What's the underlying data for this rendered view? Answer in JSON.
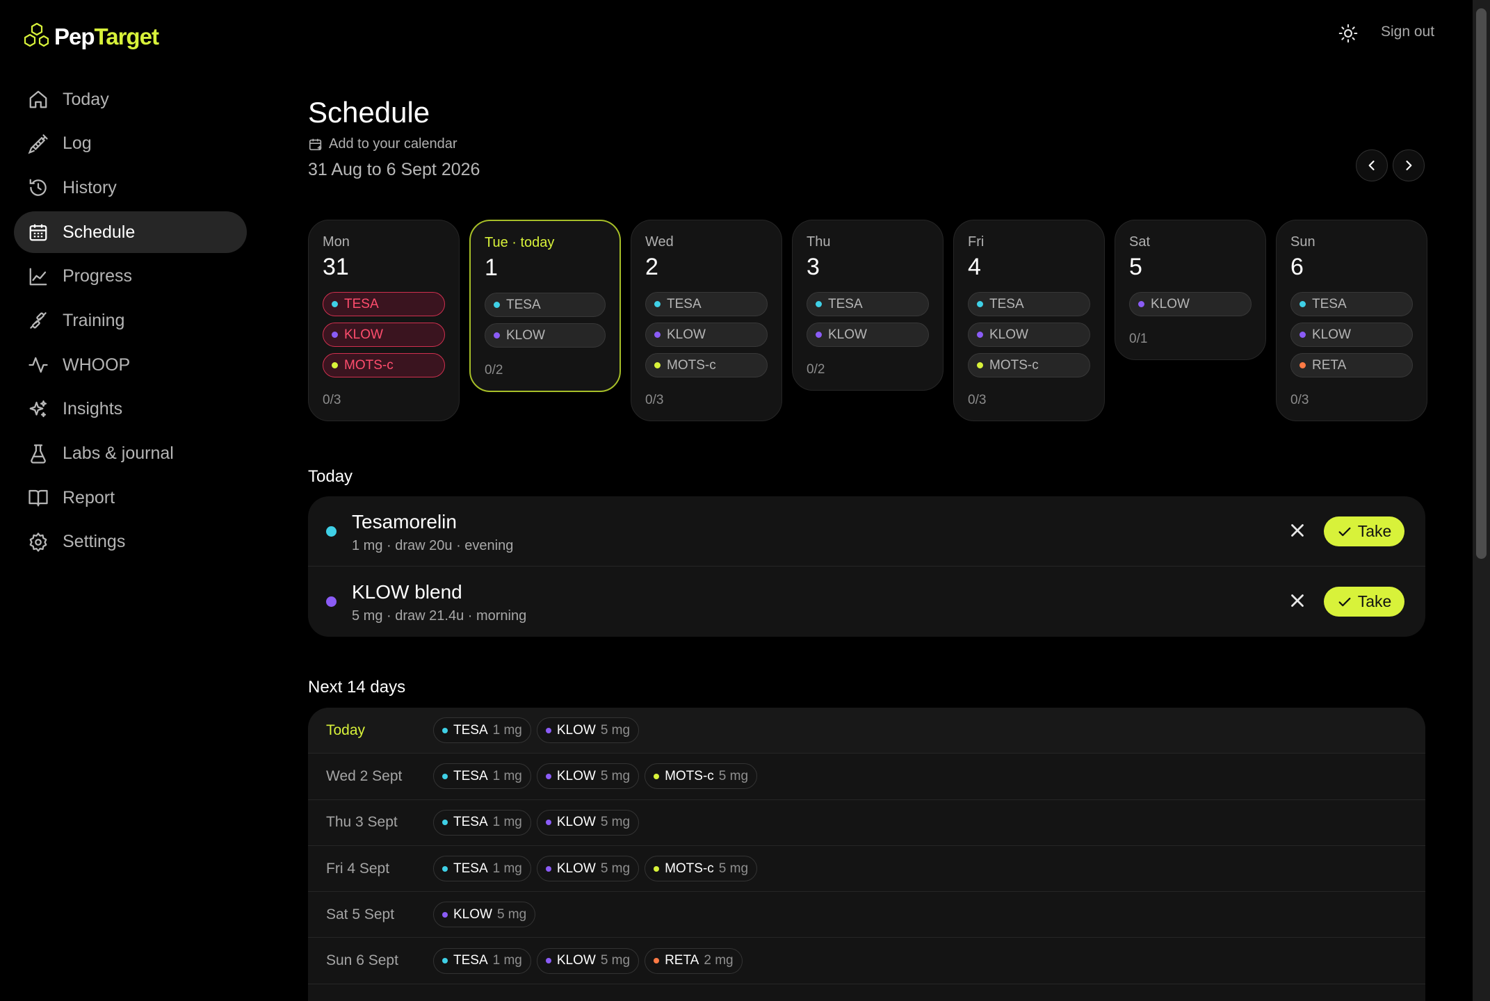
{
  "colors": {
    "accent": "#d8f23a",
    "tesa": "#3fd0e6",
    "klow": "#8b5cf6",
    "mots": "#d8f23a",
    "reta": "#ff7a45",
    "missed": "#ff4d6d"
  },
  "brand": {
    "name_part1": "Pep",
    "name_part2": "Target",
    "logo_icon": "hexagon-cluster-icon"
  },
  "topbar": {
    "theme_icon": "sun-icon",
    "sign_out": "Sign out"
  },
  "sidebar": {
    "items": [
      {
        "label": "Today",
        "icon": "home-icon",
        "active": false
      },
      {
        "label": "Log",
        "icon": "syringe-icon",
        "active": false
      },
      {
        "label": "History",
        "icon": "history-icon",
        "active": false
      },
      {
        "label": "Schedule",
        "icon": "calendar-icon",
        "active": true
      },
      {
        "label": "Progress",
        "icon": "line-chart-icon",
        "active": false
      },
      {
        "label": "Training",
        "icon": "dumbbell-icon",
        "active": false
      },
      {
        "label": "WHOOP",
        "icon": "pulse-icon",
        "active": false
      },
      {
        "label": "Insights",
        "icon": "sparkles-icon",
        "active": false
      },
      {
        "label": "Labs & journal",
        "icon": "flask-icon",
        "active": false
      },
      {
        "label": "Report",
        "icon": "book-icon",
        "active": false
      },
      {
        "label": "Settings",
        "icon": "gear-icon",
        "active": false
      }
    ]
  },
  "header": {
    "title": "Schedule",
    "add_to_calendar": "Add to your calendar",
    "date_range": "31 Aug to 6 Sept 2026",
    "prev_icon": "chevron-left-icon",
    "next_icon": "chevron-right-icon"
  },
  "week": [
    {
      "day": "Mon",
      "date": "31",
      "today": false,
      "count": "0/3",
      "doses": [
        {
          "label": "TESA",
          "color": "tesa",
          "missed": true
        },
        {
          "label": "KLOW",
          "color": "klow",
          "missed": true
        },
        {
          "label": "MOTS-c",
          "color": "mots",
          "missed": true
        }
      ]
    },
    {
      "day": "Tue · today",
      "date": "1",
      "today": true,
      "count": "0/2",
      "doses": [
        {
          "label": "TESA",
          "color": "tesa",
          "missed": false
        },
        {
          "label": "KLOW",
          "color": "klow",
          "missed": false
        }
      ]
    },
    {
      "day": "Wed",
      "date": "2",
      "today": false,
      "count": "0/3",
      "doses": [
        {
          "label": "TESA",
          "color": "tesa",
          "missed": false
        },
        {
          "label": "KLOW",
          "color": "klow",
          "missed": false
        },
        {
          "label": "MOTS-c",
          "color": "mots",
          "missed": false
        }
      ]
    },
    {
      "day": "Thu",
      "date": "3",
      "today": false,
      "count": "0/2",
      "doses": [
        {
          "label": "TESA",
          "color": "tesa",
          "missed": false
        },
        {
          "label": "KLOW",
          "color": "klow",
          "missed": false
        }
      ]
    },
    {
      "day": "Fri",
      "date": "4",
      "today": false,
      "count": "0/3",
      "doses": [
        {
          "label": "TESA",
          "color": "tesa",
          "missed": false
        },
        {
          "label": "KLOW",
          "color": "klow",
          "missed": false
        },
        {
          "label": "MOTS-c",
          "color": "mots",
          "missed": false
        }
      ]
    },
    {
      "day": "Sat",
      "date": "5",
      "today": false,
      "count": "0/1",
      "doses": [
        {
          "label": "KLOW",
          "color": "klow",
          "missed": false
        }
      ]
    },
    {
      "day": "Sun",
      "date": "6",
      "today": false,
      "count": "0/3",
      "doses": [
        {
          "label": "TESA",
          "color": "tesa",
          "missed": false
        },
        {
          "label": "KLOW",
          "color": "klow",
          "missed": false
        },
        {
          "label": "RETA",
          "color": "reta",
          "missed": false
        }
      ]
    }
  ],
  "today_section": {
    "label": "Today",
    "doses": [
      {
        "name": "Tesamorelin",
        "detail": "1 mg · draw 20u · evening",
        "color": "tesa",
        "take_label": "Take"
      },
      {
        "name": "KLOW blend",
        "detail": "5 mg · draw 21.4u · morning",
        "color": "klow",
        "take_label": "Take"
      }
    ]
  },
  "next_section": {
    "label": "Next 14 days",
    "rows": [
      {
        "date": "Today",
        "today": true,
        "doses": [
          {
            "name": "TESA",
            "dose": "1 mg",
            "color": "tesa"
          },
          {
            "name": "KLOW",
            "dose": "5 mg",
            "color": "klow"
          }
        ]
      },
      {
        "date": "Wed 2 Sept",
        "today": false,
        "doses": [
          {
            "name": "TESA",
            "dose": "1 mg",
            "color": "tesa"
          },
          {
            "name": "KLOW",
            "dose": "5 mg",
            "color": "klow"
          },
          {
            "name": "MOTS-c",
            "dose": "5 mg",
            "color": "mots"
          }
        ]
      },
      {
        "date": "Thu 3 Sept",
        "today": false,
        "doses": [
          {
            "name": "TESA",
            "dose": "1 mg",
            "color": "tesa"
          },
          {
            "name": "KLOW",
            "dose": "5 mg",
            "color": "klow"
          }
        ]
      },
      {
        "date": "Fri 4 Sept",
        "today": false,
        "doses": [
          {
            "name": "TESA",
            "dose": "1 mg",
            "color": "tesa"
          },
          {
            "name": "KLOW",
            "dose": "5 mg",
            "color": "klow"
          },
          {
            "name": "MOTS-c",
            "dose": "5 mg",
            "color": "mots"
          }
        ]
      },
      {
        "date": "Sat 5 Sept",
        "today": false,
        "doses": [
          {
            "name": "KLOW",
            "dose": "5 mg",
            "color": "klow"
          }
        ]
      },
      {
        "date": "Sun 6 Sept",
        "today": false,
        "doses": [
          {
            "name": "TESA",
            "dose": "1 mg",
            "color": "tesa"
          },
          {
            "name": "KLOW",
            "dose": "5 mg",
            "color": "klow"
          },
          {
            "name": "RETA",
            "dose": "2 mg",
            "color": "reta"
          }
        ]
      }
    ]
  }
}
